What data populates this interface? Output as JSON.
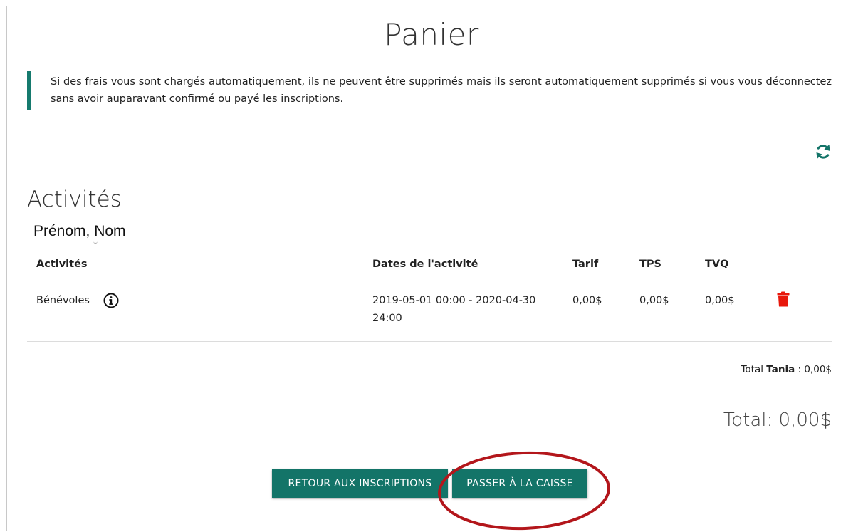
{
  "page": {
    "title": "Panier",
    "notice": "Si des frais vous sont chargés automatiquement, ils ne peuvent être supprimés mais ils seront automatiquement supprimés si vous vous déconnectez sans avoir auparavant confirmé ou payé les inscriptions."
  },
  "section": {
    "title": "Activités",
    "person": "Prénom, Nom"
  },
  "table": {
    "columns": [
      "Activités",
      "Dates de l'activité",
      "Tarif",
      "TPS",
      "TVQ"
    ],
    "rows": [
      {
        "activity": "Bénévoles",
        "dates": "2019-05-01 00:00 - 2020-04-30 24:00",
        "tarif": "0,00$",
        "tps": "0,00$",
        "tvq": "0,00$"
      }
    ]
  },
  "totals": {
    "subtotal_prefix": "Total",
    "subtotal_name": "Tania",
    "subtotal_value": " : 0,00$",
    "grand_total": "Total: 0,00$"
  },
  "buttons": {
    "back": "RETOUR AUX INSCRIPTIONS",
    "checkout": "PASSER À LA CAISSE"
  },
  "icons": {
    "refresh": "refresh-icon",
    "info": "info-icon",
    "trash": "trash-icon"
  },
  "colors": {
    "accent": "#137468",
    "delete": "#e8180c",
    "annotation": "#b3161b"
  }
}
